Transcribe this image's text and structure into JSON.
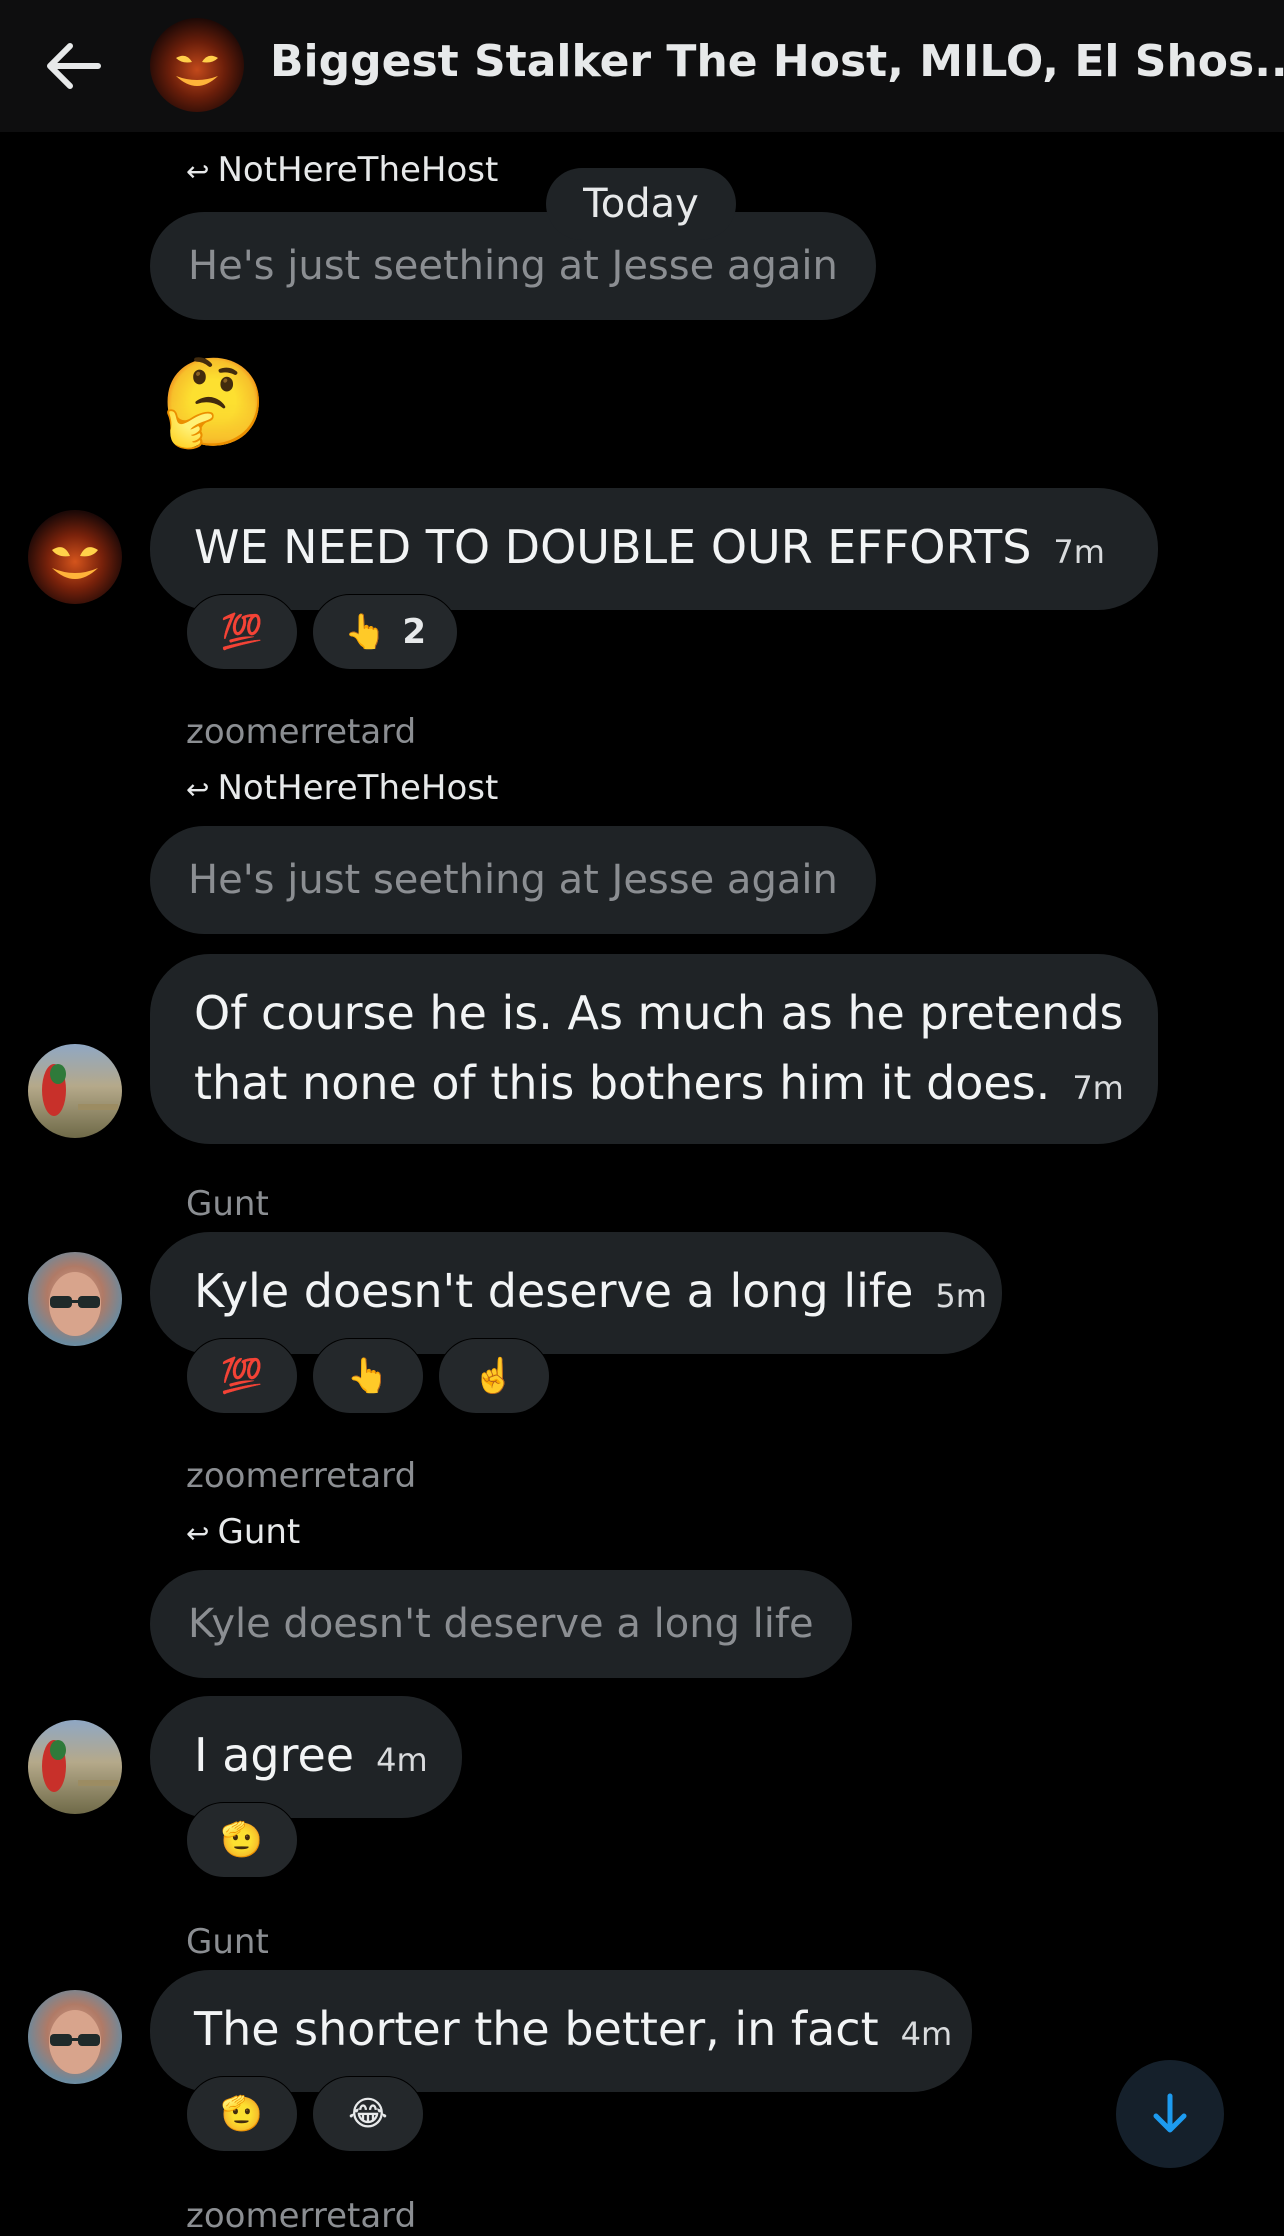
{
  "header": {
    "title": "Biggest Stalker The Host, MILO, El Shos...",
    "back_icon": "arrow-left-icon",
    "avatar_icon": "demon-avatar"
  },
  "date_divider": "Today",
  "messages": [
    {
      "reply_to": "NotHereTheHost",
      "quoted": "He's just seething at Jesse again"
    },
    {
      "emoji": "🤔"
    },
    {
      "text": "WE NEED TO DOUBLE OUR EFFORTS",
      "time": "7m",
      "reactions": [
        {
          "emoji": "💯",
          "count": ""
        },
        {
          "emoji": "👆",
          "count": "2"
        }
      ]
    },
    {
      "sender": "zoomerretard",
      "reply_to": "NotHereTheHost",
      "quoted": "He's just seething at Jesse again",
      "text_line1": "Of course he is. As much as he pretends",
      "text_line2": "that none of this bothers him it does.",
      "time": "7m"
    },
    {
      "sender": "Gunt",
      "text": "Kyle doesn't deserve a long life",
      "time": "5m",
      "reactions": [
        {
          "emoji": "💯"
        },
        {
          "emoji": "👆"
        },
        {
          "emoji": "☝️"
        }
      ]
    },
    {
      "sender": "zoomerretard",
      "reply_to": "Gunt",
      "quoted": "Kyle doesn't deserve a long life",
      "text": "I agree",
      "time": "4m",
      "reactions": [
        {
          "emoji": "🫡"
        }
      ]
    },
    {
      "sender": "Gunt",
      "text": "The shorter the better, in fact",
      "time": "4m",
      "reactions": [
        {
          "emoji": "🫡"
        },
        {
          "emoji": "😂"
        }
      ]
    },
    {
      "sender": "zoomerretard"
    }
  ],
  "scroll_down_icon": "arrow-down-icon",
  "colors": {
    "background": "#000000",
    "bubble": "#1f2326",
    "accent": "#1d9bf0"
  }
}
